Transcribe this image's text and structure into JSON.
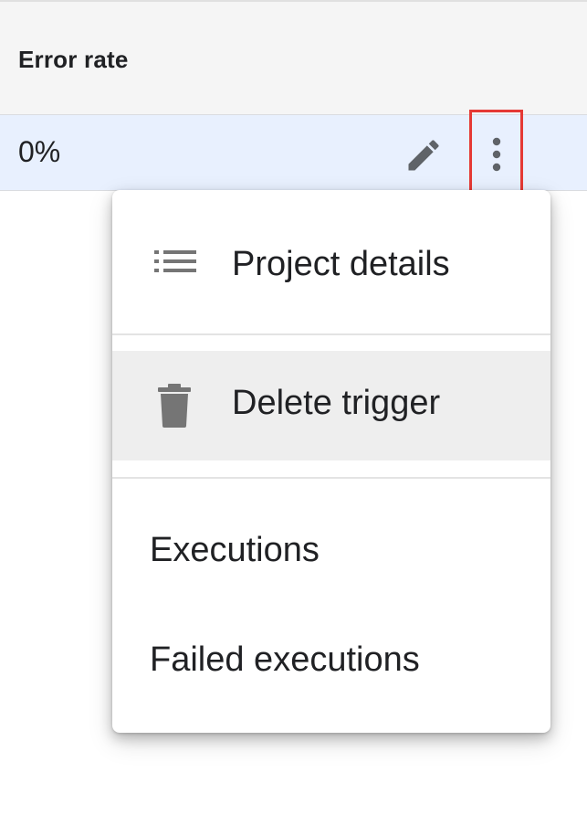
{
  "table": {
    "header": {
      "column_label": "Error rate"
    },
    "row": {
      "error_rate": "0%",
      "actions": {
        "edit_icon": "pencil-icon",
        "more_icon": "more-vert-icon"
      }
    }
  },
  "highlight_color": "#e53935",
  "menu": {
    "items": [
      {
        "label": "Project details",
        "icon": "list-icon"
      },
      {
        "label": "Delete trigger",
        "icon": "trash-icon",
        "hovered": true
      },
      {
        "label": "Executions"
      },
      {
        "label": "Failed executions"
      }
    ]
  }
}
